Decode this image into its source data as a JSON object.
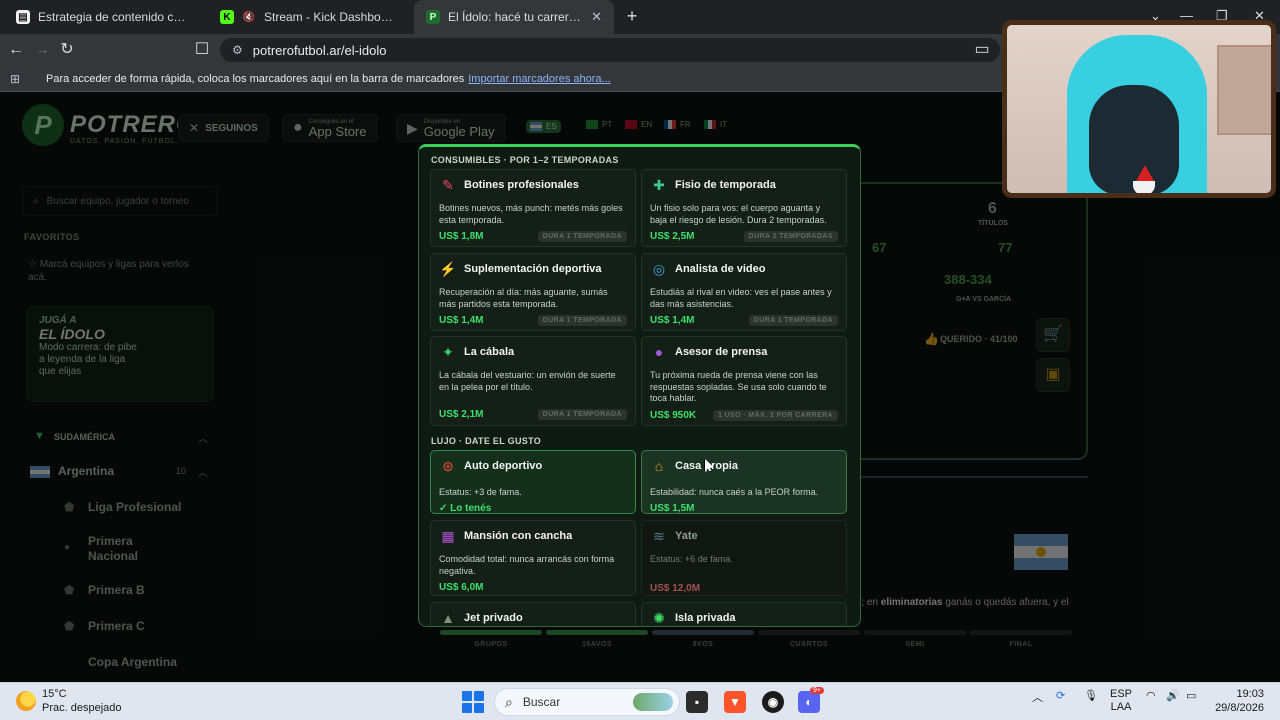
{
  "browser": {
    "tabs": [
      {
        "title": "Estrategia de contenido corto",
        "favicon_color": "#f2f2f2"
      },
      {
        "title": "Stream - Kick Dashboard",
        "favicon_color": "#53fc18"
      },
      {
        "title": "El Ídolo: hacé tu carrera de futbo",
        "favicon_color": "#2ecc71"
      }
    ],
    "url": "potrerofutbol.ar/el-idolo",
    "bookmarks_text": "Para acceder de forma rápida, coloca los marcadores aquí en la barra de marcadores",
    "bookmarks_link": "Importar marcadores ahora..."
  },
  "site": {
    "logo_letter": "P",
    "logo_text": "POTRERO",
    "logo_sub": "DATOS. PASIÓN. FÚTBOL.",
    "follow_label": "SEGUINOS",
    "app_store_small": "Conseguilo en el",
    "app_store_big": "App Store",
    "google_play_small": "Disponible en",
    "google_play_big": "Google Play",
    "languages": [
      "ES",
      "PT",
      "EN",
      "FR",
      "IT"
    ],
    "search_placeholder": "Buscar equipo, jugador o torneo",
    "favorites_title": "FAVORITOS",
    "favorites_note": "Marcá equipos y ligas para verlos acá.",
    "promo": {
      "line1": "JUGÁ A",
      "line2": "EL ÍDOLO",
      "line3": "Modo carrera: de pibe a leyenda de la liga que elijas"
    },
    "region": "SUDAMÉRICA",
    "country": "Argentina",
    "country_count": "10",
    "leagues": [
      "Liga Profesional",
      "Primera Nacional",
      "Primera B",
      "Primera C",
      "Copa Argentina"
    ],
    "right_panel": {
      "titles_value": "6",
      "titles_label": "TÍTULOS",
      "stat_a": "67",
      "stat_b": "77",
      "record": "388-334",
      "record_label": "G+A VS GARCÍA",
      "querido": "QUERIDO · 41/100"
    },
    "stage_text_prefix": "); en",
    "stage_text_bold": "eliminatorias",
    "stage_text_suffix": "ganás o quedás afuera, y el",
    "stages": [
      "GRUPOS",
      "16AVOS",
      "8VOS",
      "CUARTOS",
      "SEMI",
      "FINAL"
    ]
  },
  "modal": {
    "section1": "CONSUMIBLES · POR 1–2 TEMPORADAS",
    "section2": "LUJO · DATE EL GUSTO",
    "consumables": [
      {
        "title": "Botines profesionales",
        "desc": "Botines nuevos, más punch: metés más goles esta temporada.",
        "price": "US$ 1,8M",
        "duration": "DURA 1 TEMPORADA",
        "icon": "cleats-icon",
        "glyph": "👟",
        "color": "#e84a6a"
      },
      {
        "title": "Fisio de temporada",
        "desc": "Un fisio solo para vos: el cuerpo aguanta y baja el riesgo de lesión. Dura 2 temporadas.",
        "price": "US$ 2,5M",
        "duration": "DURA 2 TEMPORADAS",
        "icon": "bandage-icon",
        "glyph": "✚",
        "color": "#3ec98a"
      },
      {
        "title": "Suplementación deportiva",
        "desc": "Recuperación al día: más aguante, sumás más partidos esta temporada.",
        "price": "US$ 1,4M",
        "duration": "DURA 1 TEMPORADA",
        "icon": "lightning-icon",
        "glyph": "⚡",
        "color": "#f5c518"
      },
      {
        "title": "Analista de video",
        "desc": "Estudiás al rival en video: ves el pase antes y das más asistencias.",
        "price": "US$ 1,4M",
        "duration": "DURA 1 TEMPORADA",
        "icon": "video-analyst-icon",
        "glyph": "◎",
        "color": "#3aa6d8"
      },
      {
        "title": "La cábala",
        "desc": "La cábala del vestuario: un envión de suerte en la pelea por el título.",
        "price": "US$ 2,1M",
        "duration": "DURA 1 TEMPORADA",
        "icon": "lucky-charm-icon",
        "glyph": "✦",
        "color": "#41c96a"
      },
      {
        "title": "Asesor de prensa",
        "desc": "Tu próxima rueda de prensa viene con las respuestas sopladas. Se usa solo cuando te toca hablar.",
        "price": "US$ 950K",
        "duration": "1 USO · MÁX. 2 POR CARRERA",
        "icon": "microphone-icon",
        "glyph": "🎙",
        "color": "#9b59d6"
      }
    ],
    "luxury": [
      {
        "title": "Auto deportivo",
        "desc": "Estatus: +3 de fama.",
        "status": "✓ Lo tenés",
        "state": "owned",
        "icon": "sports-car-icon",
        "glyph": "⊛",
        "color": "#e74c3c"
      },
      {
        "title": "Casa propia",
        "desc": "Estabilidad: nunca caés a la PEOR forma.",
        "price": "US$ 1,5M",
        "state": "hover",
        "icon": "house-icon",
        "glyph": "⌂",
        "color": "#d4a017"
      },
      {
        "title": "Mansión con cancha",
        "desc": "Comodidad total: nunca arrancás con forma negativa.",
        "price": "US$ 6,0M",
        "state": "available",
        "icon": "mansion-icon",
        "glyph": "▦",
        "color": "#b455d8"
      },
      {
        "title": "Yate",
        "desc": "Estatus: +6 de fama.",
        "price": "US$ 12,0M",
        "state": "locked",
        "icon": "yacht-icon",
        "glyph": "≋",
        "color": "#5f7d86"
      },
      {
        "title": "Jet privado",
        "state": "available",
        "icon": "jet-icon",
        "glyph": "▲",
        "color": "#7d8d81"
      },
      {
        "title": "Isla privada",
        "state": "available",
        "icon": "island-icon",
        "glyph": "✺",
        "color": "#3ee06a"
      }
    ]
  },
  "taskbar": {
    "temp": "15°C",
    "weather": "Prac. despejado",
    "search_label": "Buscar",
    "lang_top": "ESP",
    "lang_bottom": "LAA",
    "time": "19:03",
    "date": "29/8/2026",
    "notif_badge": "9+"
  }
}
